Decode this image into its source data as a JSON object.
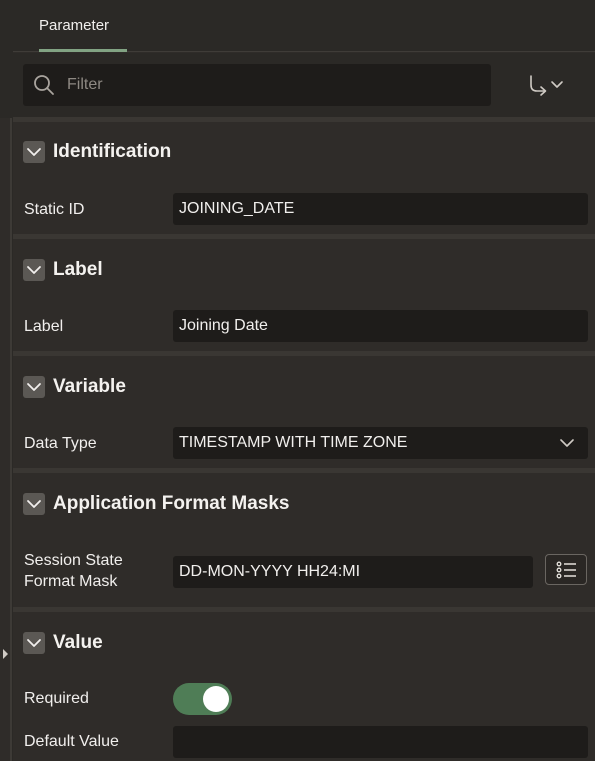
{
  "tabs": [
    {
      "label": "Parameter",
      "active": true
    }
  ],
  "toolbar": {
    "filter_placeholder": "Filter",
    "search_icon": "search-icon",
    "goto_icon": "goto-group-icon"
  },
  "sections": {
    "identification": {
      "title": "Identification",
      "fields": {
        "static_id": {
          "label": "Static ID",
          "value": "JOINING_DATE"
        }
      }
    },
    "label": {
      "title": "Label",
      "fields": {
        "label": {
          "label": "Label",
          "value": "Joining Date"
        }
      }
    },
    "variable": {
      "title": "Variable",
      "fields": {
        "data_type": {
          "label": "Data Type",
          "value": "TIMESTAMP WITH TIME ZONE"
        }
      }
    },
    "format_masks": {
      "title": "Application Format Masks",
      "fields": {
        "session_state_format_mask": {
          "label_line1": "Session State",
          "label_line2": "Format Mask",
          "value": "DD-MON-YYYY HH24:MI"
        }
      }
    },
    "value": {
      "title": "Value",
      "fields": {
        "required": {
          "label": "Required",
          "value": true
        },
        "default_value": {
          "label": "Default Value",
          "value": ""
        }
      }
    }
  },
  "colors": {
    "accent_tab": "#82a383",
    "toggle_on": "#4f7d56",
    "background": "#2f2c29",
    "input_bg": "#1e1c1a"
  }
}
